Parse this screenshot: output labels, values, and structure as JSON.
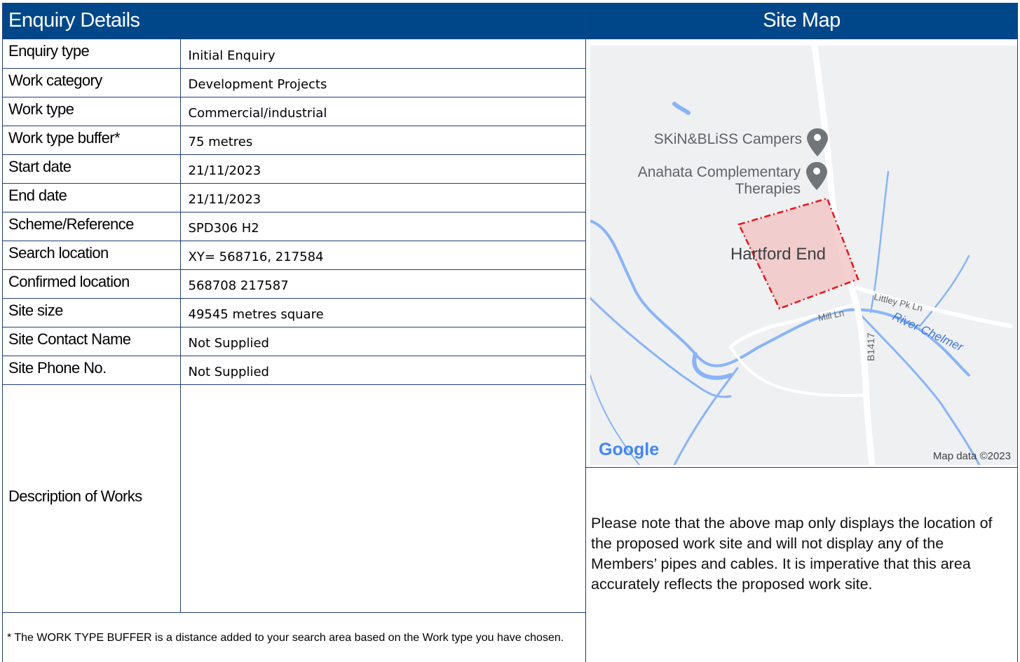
{
  "enquiry": {
    "title": "Enquiry Details",
    "rows": [
      {
        "label": "Enquiry type",
        "value": "Initial Enquiry"
      },
      {
        "label": "Work category",
        "value": "Development Projects"
      },
      {
        "label": "Work type",
        "value": "Commercial/industrial"
      },
      {
        "label": "Work type buffer*",
        "value": "75 metres"
      },
      {
        "label": "Start date",
        "value": "21/11/2023"
      },
      {
        "label": "End date",
        "value": "21/11/2023"
      },
      {
        "label": "Scheme/Reference",
        "value": "SPD306 H2"
      },
      {
        "label": "Search location",
        "value": "XY= 568716, 217584"
      },
      {
        "label": "Confirmed location",
        "value": "568708 217587"
      },
      {
        "label": "Site size",
        "value": "49545 metres square"
      },
      {
        "label": "Site Contact Name",
        "value": "Not Supplied"
      },
      {
        "label": "Site Phone No.",
        "value": "Not Supplied"
      }
    ],
    "description_label": "Description of Works",
    "description_value": "",
    "footnote": "* The WORK TYPE BUFFER is a distance added to your search area based on the Work type you have chosen."
  },
  "site_map": {
    "title": "Site Map",
    "places": {
      "campers": "SKiN&BLiSS Campers",
      "therapies_line1": "Anahata Complementary",
      "therapies_line2": "Therapies",
      "village": "Hartford End",
      "road_littley": "Littley Pk Ln",
      "road_mill": "Mill Ln",
      "road_b1417": "B1417",
      "river": "River Chelmer"
    },
    "logo": "Google",
    "attribution": "Map data ©2023",
    "colors": {
      "site_fill": "#f2c4c4",
      "site_border": "#e8141c",
      "water": "#8ab4f8",
      "land": "#f1f3f4"
    },
    "note": "Please note that the above map only displays the location of the proposed work site and will not display any of the Members’ pipes and cables.  It is imperative that this area accurately reflects the proposed work site."
  }
}
